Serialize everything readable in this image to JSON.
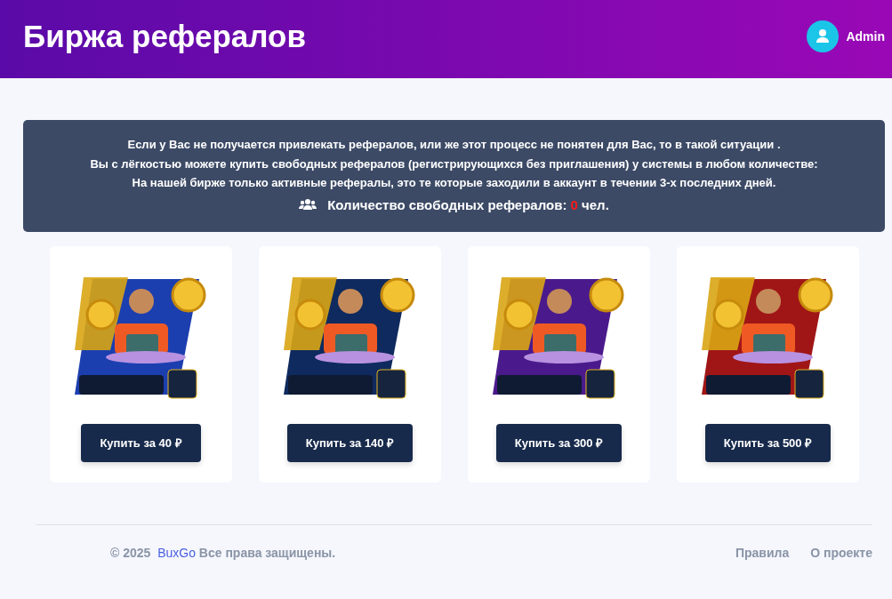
{
  "header": {
    "title": "Биржа рефералов",
    "user": "Admin"
  },
  "info": {
    "lines": [
      "Если у Вас не получается привлекать рефералов, или же этот процесс не понятен для Вас, то в такой ситуации .",
      "Вы с лёгкостью можете купить свободных рефералов (регистрирующихся без приглашения) у системы в любом количестве:",
      "На нашей бирже только активные рефералы, это те которые заходили в аккаунт в течении 3-х последних дней."
    ],
    "count_label": "Количество свободных рефералов:",
    "count": "0",
    "count_unit": "чел."
  },
  "packages": [
    {
      "color": "#1c3fb0",
      "button": "Купить за 40 ₽"
    },
    {
      "color": "#0f2a5e",
      "button": "Купить за 140 ₽"
    },
    {
      "color": "#4a1a8c",
      "button": "Купить за 300 ₽"
    },
    {
      "color": "#a01616",
      "button": "Купить за 500 ₽"
    }
  ],
  "footer": {
    "year": "© 2025",
    "brand": "BuxGo",
    "rights": "Все права защищены.",
    "links": [
      "Правила",
      "О проекте"
    ]
  }
}
